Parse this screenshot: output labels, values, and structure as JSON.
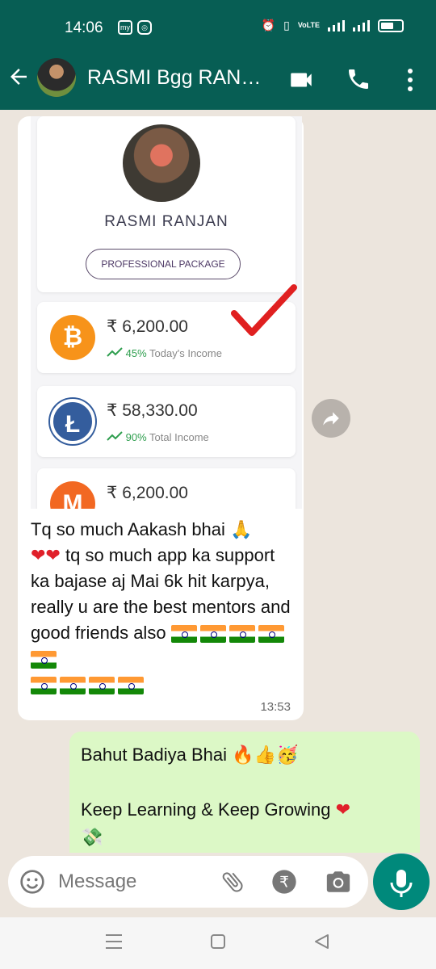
{
  "status_bar": {
    "time": "14:06",
    "network_label": "VoLTE"
  },
  "header": {
    "back_icon": "back-arrow-icon",
    "title": "RASMI Bgg RAN…"
  },
  "incoming": {
    "screenshot": {
      "name": "RASMI RANJAN",
      "package_button": "PROFESSIONAL PACKAGE",
      "cards": [
        {
          "amount": "₹ 6,200.00",
          "percent": "45%",
          "label": "Today's Income",
          "coin": "bitcoin",
          "color": "#f7931a"
        },
        {
          "amount": "₹ 58,330.00",
          "percent": "90%",
          "label": "Total Income",
          "coin": "litecoin",
          "color": "#345d9d"
        },
        {
          "amount": "₹ 6,200.00",
          "coin": "monero",
          "color": "#f26822"
        }
      ]
    },
    "line1": "Tq so much Aakash bhai",
    "line2": "tq so much app ka support ka bajase aj Mai 6k hit  karpya, really u are the best mentors and good friends also",
    "time": "13:53"
  },
  "outgoing": {
    "line1": "Bahut Badiya Bhai",
    "line2": "Keep Learning & Keep Growing"
  },
  "input": {
    "placeholder": "Message"
  },
  "colors": {
    "header_bg": "#075e54",
    "chat_bg": "#ece5dd",
    "outgoing_bubble": "#dcf8c6",
    "mic_button": "#00897b"
  }
}
